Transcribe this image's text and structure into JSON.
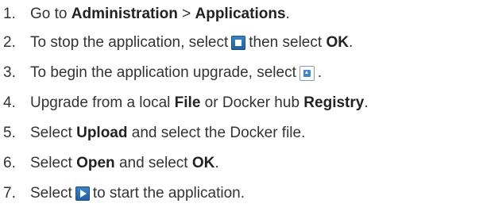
{
  "steps": [
    {
      "number": "1.",
      "parts": [
        "Go to ",
        "Administration",
        " > ",
        "Applications",
        "."
      ]
    },
    {
      "number": "2.",
      "parts": [
        "To stop the application, select ",
        "then select ",
        "OK",
        "."
      ],
      "icon": "stop-icon"
    },
    {
      "number": "3.",
      "parts": [
        "To begin the application upgrade, select ",
        "."
      ],
      "icon": "upgrade-icon"
    },
    {
      "number": "4.",
      "parts": [
        "Upgrade from a local ",
        "File",
        " or Docker hub ",
        "Registry",
        "."
      ]
    },
    {
      "number": "5.",
      "parts": [
        "Select ",
        "Upload",
        " and select the Docker file."
      ]
    },
    {
      "number": "6.",
      "parts": [
        "Select ",
        "Open",
        " and select ",
        "OK",
        "."
      ]
    },
    {
      "number": "7.",
      "parts": [
        "Select ",
        "to start the application."
      ],
      "icon": "start-icon"
    }
  ]
}
